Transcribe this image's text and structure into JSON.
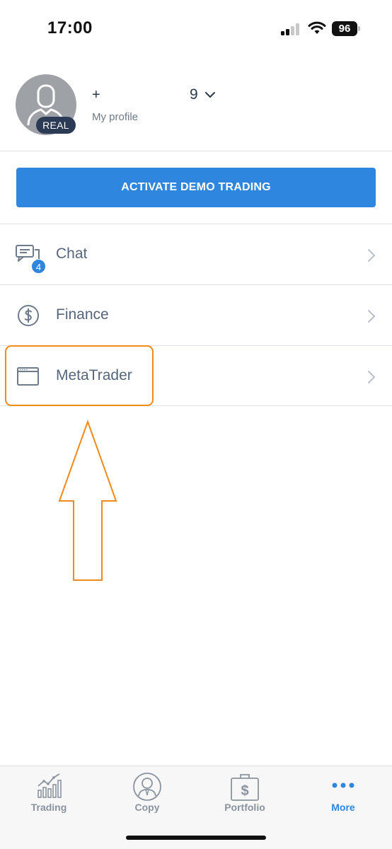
{
  "status_bar": {
    "time": "17:00",
    "battery": "96"
  },
  "profile": {
    "badge": "REAL",
    "phone_prefix": "+",
    "phone_suffix": "9",
    "link_label": "My profile"
  },
  "demo_button": {
    "label": "ACTIVATE DEMO TRADING"
  },
  "menu": {
    "items": [
      {
        "label": "Chat",
        "icon": "chat-icon",
        "badge": "4"
      },
      {
        "label": "Finance",
        "icon": "dollar-circle-icon"
      },
      {
        "label": "MetaTrader",
        "icon": "window-icon"
      }
    ]
  },
  "annotation": {
    "highlight_color": "#f28a18"
  },
  "tab_bar": {
    "tabs": [
      {
        "label": "Trading",
        "icon": "trading-chart-icon",
        "active": false
      },
      {
        "label": "Copy",
        "icon": "person-icon",
        "active": false
      },
      {
        "label": "Portfolio",
        "icon": "briefcase-dollar-icon",
        "active": false
      },
      {
        "label": "More",
        "icon": "more-dots-icon",
        "active": true
      }
    ]
  },
  "colors": {
    "accent": "#2f86de",
    "text": "#56657a",
    "badge_dark": "#2b3a55"
  }
}
